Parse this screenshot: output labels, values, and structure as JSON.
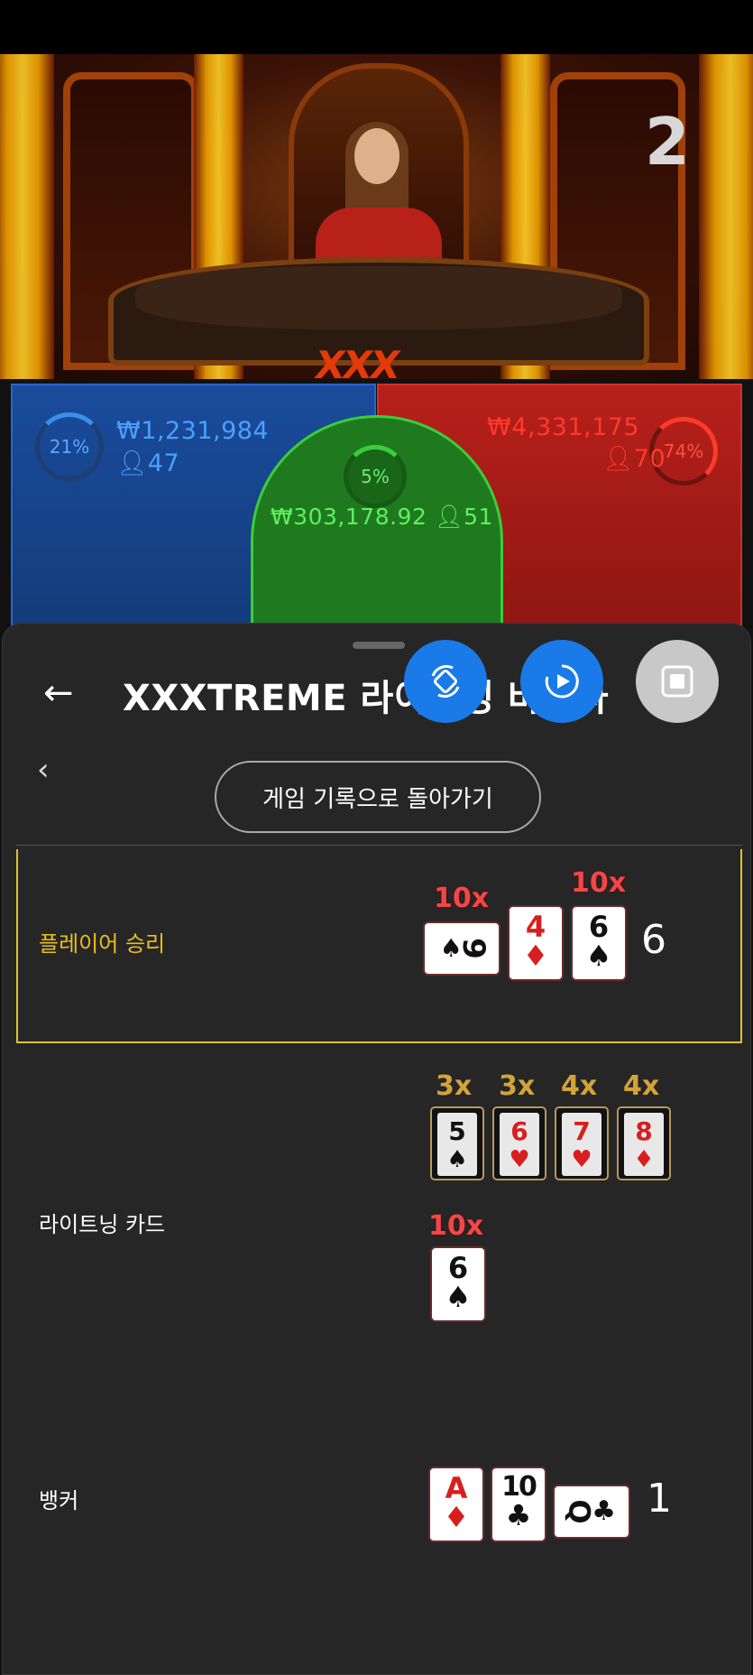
{
  "stream": {
    "round_number": "2",
    "logo": "XXX"
  },
  "bets": {
    "player": {
      "percent": "21%",
      "amount": "₩1,231,984",
      "count": "47"
    },
    "banker": {
      "percent": "74%",
      "amount": "₩4,331,175",
      "count": "70"
    },
    "tie": {
      "percent": "5%",
      "amount": "₩303,178.92",
      "count": "51"
    }
  },
  "sheet": {
    "title": "XXXTREME 라이트닝 바카라",
    "back_to_history_label": "게임 기록으로 돌아가기",
    "rows": {
      "player_label": "플레이어 승리",
      "player_score": "6",
      "lightning_label": "라이트닝 카드",
      "banker_label": "뱅커",
      "banker_score": "1"
    },
    "player_cards": [
      {
        "rank": "9",
        "suit": "♠",
        "color": "black",
        "multiplier": "10x",
        "sideways": true
      },
      {
        "rank": "4",
        "suit": "♦",
        "color": "red",
        "multiplier": ""
      },
      {
        "rank": "6",
        "suit": "♠",
        "color": "black",
        "multiplier": "10x"
      }
    ],
    "lightning_cards": [
      {
        "rank": "5",
        "suit": "♠",
        "color": "black",
        "multiplier": "3x"
      },
      {
        "rank": "6",
        "suit": "♥",
        "color": "red",
        "multiplier": "3x"
      },
      {
        "rank": "7",
        "suit": "♥",
        "color": "red",
        "multiplier": "4x"
      },
      {
        "rank": "8",
        "suit": "♦",
        "color": "red",
        "multiplier": "4x"
      }
    ],
    "lightning_extra": {
      "rank": "6",
      "suit": "♠",
      "color": "black",
      "multiplier": "10x"
    },
    "banker_cards": [
      {
        "rank": "A",
        "suit": "♦",
        "color": "red"
      },
      {
        "rank": "10",
        "suit": "♣",
        "color": "black"
      },
      {
        "rank": "Q",
        "suit": "♣",
        "color": "black",
        "sideways": true
      }
    ]
  },
  "icons": {
    "back": "arrow-left-icon",
    "chevron": "chevron-left-icon",
    "rotate": "rotate-icon",
    "record": "screen-record-icon",
    "stop": "stop-icon",
    "person": "person-icon"
  },
  "colors": {
    "player": "#2a66c8",
    "banker": "#d0302a",
    "tie": "#3acd3a",
    "highlight": "#e3c12a"
  }
}
